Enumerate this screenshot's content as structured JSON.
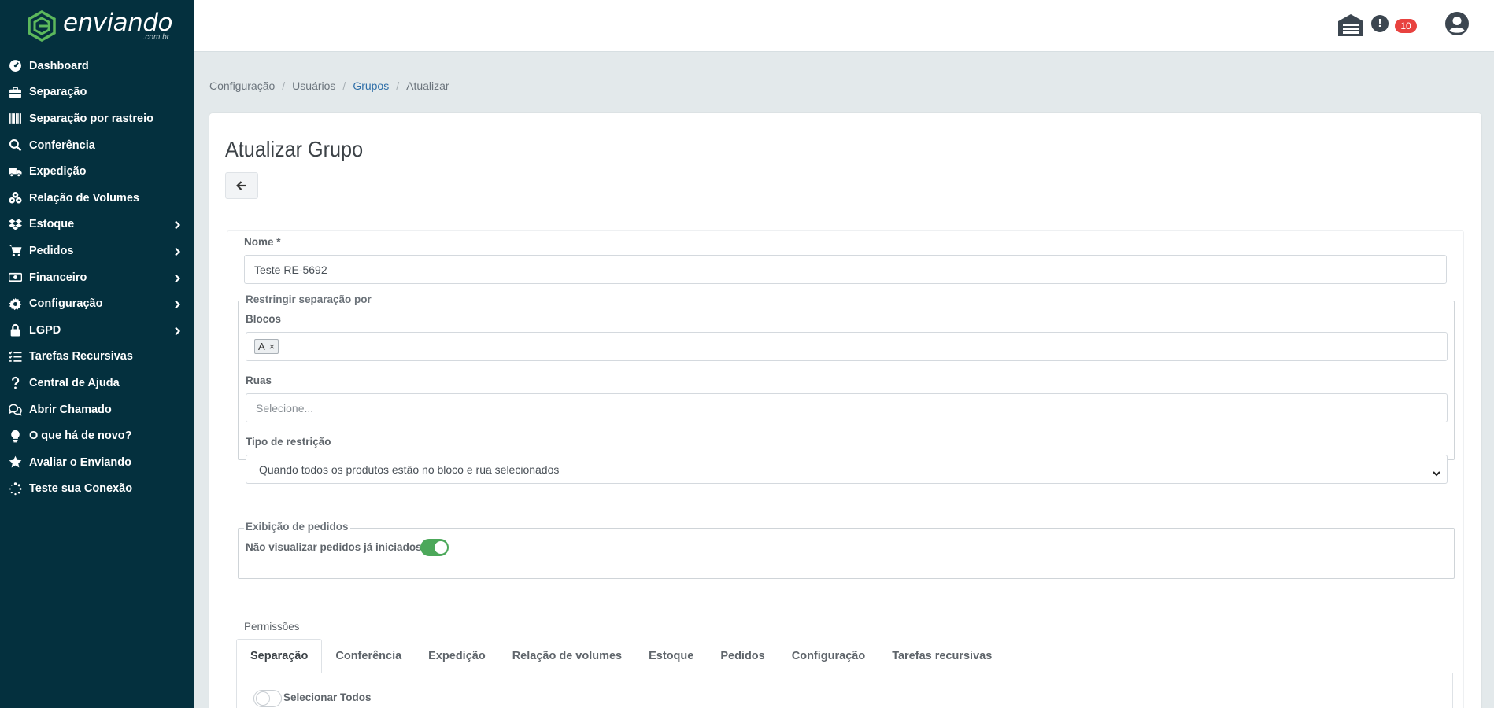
{
  "brand": {
    "name": "enviando",
    "domain_suffix": ".com.br",
    "accent": "#5cb85c",
    "sidebar_bg": "#04303e"
  },
  "sidebar": {
    "items": [
      {
        "label": "Dashboard",
        "icon": "gauge-icon",
        "submenu": false
      },
      {
        "label": "Separação",
        "icon": "briefcase-icon",
        "submenu": false
      },
      {
        "label": "Separação por rastreio",
        "icon": "barcode-icon",
        "submenu": false
      },
      {
        "label": "Conferência",
        "icon": "search-icon",
        "submenu": false
      },
      {
        "label": "Expedição",
        "icon": "truck-icon",
        "submenu": false
      },
      {
        "label": "Relação de Volumes",
        "icon": "boxes-icon",
        "submenu": false
      },
      {
        "label": "Estoque",
        "icon": "dropbox-icon",
        "submenu": true
      },
      {
        "label": "Pedidos",
        "icon": "cart-icon",
        "submenu": true
      },
      {
        "label": "Financeiro",
        "icon": "money-icon",
        "submenu": true
      },
      {
        "label": "Configuração",
        "icon": "gear-icon",
        "submenu": true
      },
      {
        "label": "LGPD",
        "icon": "lock-icon",
        "submenu": true
      },
      {
        "label": "Tarefas Recursivas",
        "icon": "tasks-icon",
        "submenu": false
      },
      {
        "label": "Central de Ajuda",
        "icon": "question-icon",
        "submenu": false
      },
      {
        "label": "Abrir Chamado",
        "icon": "chat-icon",
        "submenu": false
      },
      {
        "label": "O que há de novo?",
        "icon": "lightbulb-icon",
        "submenu": false
      },
      {
        "label": "Avaliar o Enviando",
        "icon": "star-icon",
        "submenu": false
      },
      {
        "label": "Teste sua Conexão",
        "icon": "spinner-icon",
        "submenu": false
      }
    ]
  },
  "topbar": {
    "alert_symbol": "!",
    "alert_count": "10"
  },
  "breadcrumb": {
    "items": [
      "Configuração",
      "Usuários",
      "Grupos",
      "Atualizar"
    ]
  },
  "page": {
    "title": "Atualizar Grupo"
  },
  "form": {
    "nome_label": "Nome *",
    "nome_value": "Teste RE-5692",
    "restringir": {
      "legend": "Restringir separação por",
      "blocos_label": "Blocos",
      "blocos_tags": [
        "A"
      ],
      "tag_remove_symbol": "×",
      "ruas_label": "Ruas",
      "ruas_placeholder": "Selecione...",
      "tipo_label": "Tipo de restrição",
      "tipo_value": "Quando todos os produtos estão no bloco e rua selecionados"
    },
    "exibicao": {
      "legend": "Exibição de pedidos",
      "toggle_label": "Não visualizar pedidos já iniciados",
      "toggle_on": true
    },
    "permissoes": {
      "label": "Permissões",
      "tabs": [
        "Separação",
        "Conferência",
        "Expedição",
        "Relação de volumes",
        "Estoque",
        "Pedidos",
        "Configuração",
        "Tarefas recursivas"
      ],
      "active_tab": "Separação",
      "select_all_label": "Selecionar Todos",
      "select_all_on": false
    }
  }
}
